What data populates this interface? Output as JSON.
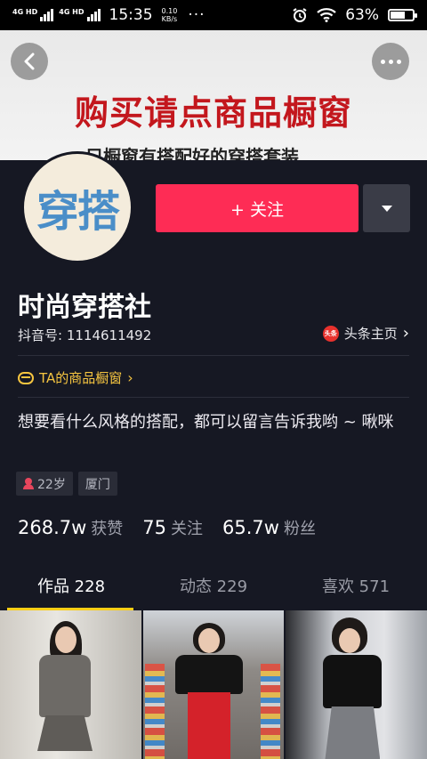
{
  "status_bar": {
    "signal1": "4G HD",
    "signal2": "4G HD",
    "time": "15:35",
    "speed_value": "0.10",
    "speed_unit": "KB/s",
    "more": "···",
    "battery": "63%",
    "battery_level": 0.63
  },
  "cover": {
    "title": "购买请点商品橱窗",
    "subtitle": "只橱窗有搭配好的穿搭套装"
  },
  "profile": {
    "avatar_text": "穿搭",
    "follow_label": "+ 关注",
    "name": "时尚穿搭社",
    "douyin_id": "抖音号: 1114611492",
    "toutiao_badge": "头条",
    "toutiao_label": "头条主页",
    "shop_label": "TA的商品橱窗",
    "bio": "想要看什么风格的搭配，都可以留言告诉我哟 ~ 啾咪",
    "tags": {
      "age": "22岁",
      "city": "厦门"
    }
  },
  "stats": {
    "likes_value": "268.7w",
    "likes_label": "获赞",
    "following_value": "75",
    "following_label": "关注",
    "followers_value": "65.7w",
    "followers_label": "粉丝"
  },
  "tabs": [
    {
      "label": "作品 228"
    },
    {
      "label": "动态 229"
    },
    {
      "label": "喜欢 571"
    }
  ],
  "colors": {
    "background": "#161823",
    "follow": "#fe2c55",
    "shop": "#f6c540",
    "tab_indicator": "#face15"
  }
}
